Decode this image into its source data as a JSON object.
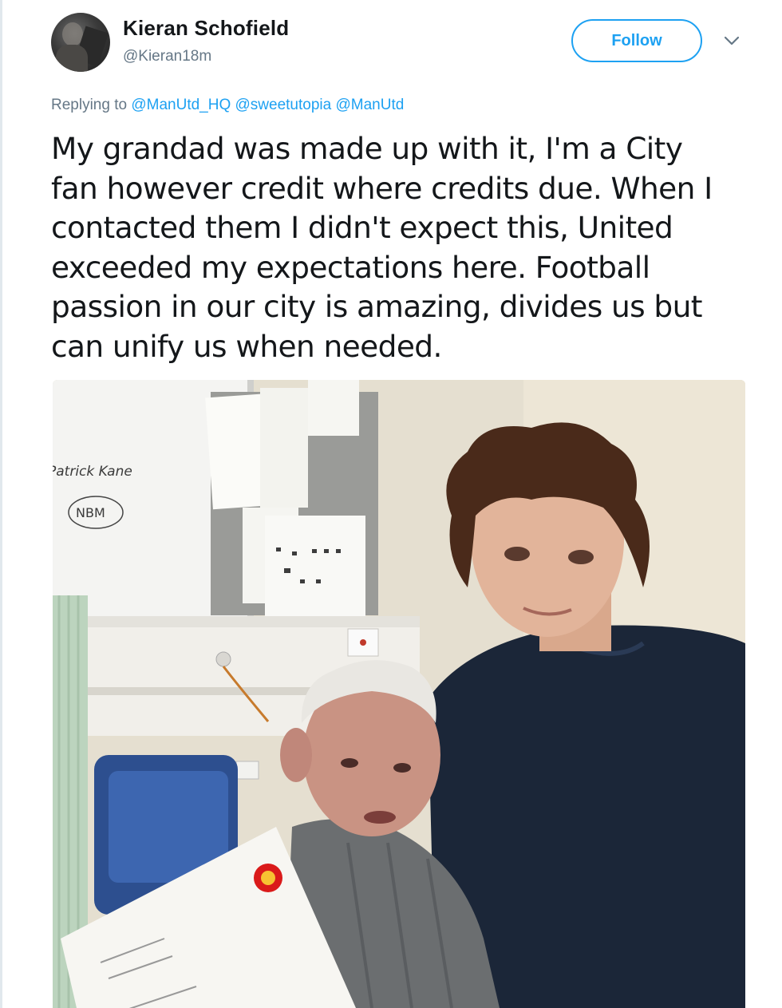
{
  "tweet": {
    "author": {
      "display_name": "Kieran Schofield",
      "handle": "@Kieran18m"
    },
    "follow_label": "Follow",
    "menu_icon": "chevron-down-icon",
    "reply": {
      "prefix": "Replying to",
      "mentions": [
        "@ManUtd_HQ",
        "@sweetutopia",
        "@ManUtd"
      ]
    },
    "text_lines": [
      "My grandad was made up with it, I'm a City",
      "fan however credit where credits due. When I",
      "contacted them I didn't expect this, United",
      "exceeded my expectations here. Football",
      "passion in our city is amazing, divides us but",
      "can unify us when needed."
    ],
    "photo": {
      "whiteboard_name": "Patrick Kane",
      "whiteboard_initials": "NBM"
    }
  },
  "colors": {
    "accent": "#1da1f2",
    "secondary_text": "#657786",
    "primary_text": "#14171a"
  }
}
